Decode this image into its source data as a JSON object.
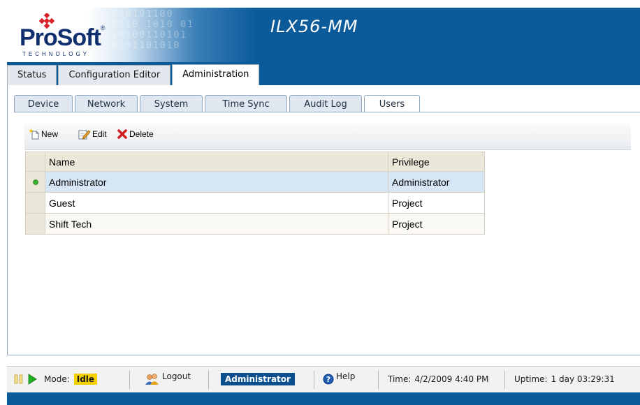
{
  "app": {
    "title": "ILX56-MM",
    "logo": {
      "brand": "ProSoft",
      "sub": "TECHNOLOGY",
      "reg_mark": "®",
      "binary_pattern": "010101100\n0110 1010 01\n10100110101\n0101101010"
    }
  },
  "main_tabs": [
    {
      "label": "Status",
      "active": false
    },
    {
      "label": "Configuration Editor",
      "active": false
    },
    {
      "label": "Administration",
      "active": true
    }
  ],
  "sub_tabs": [
    {
      "label": "Device",
      "active": false
    },
    {
      "label": "Network",
      "active": false
    },
    {
      "label": "System",
      "active": false
    },
    {
      "label": "Time Sync",
      "active": false
    },
    {
      "label": "Audit Log",
      "active": false
    },
    {
      "label": "Users",
      "active": true
    }
  ],
  "toolbar": {
    "new_label": "New",
    "edit_label": "Edit",
    "delete_label": "Delete"
  },
  "users_table": {
    "columns": [
      "Name",
      "Privilege"
    ],
    "rows": [
      {
        "name": "Administrator",
        "privilege": "Administrator",
        "selected": true
      },
      {
        "name": "Guest",
        "privilege": "Project",
        "selected": false
      },
      {
        "name": "Shift Tech",
        "privilege": "Project",
        "selected": false
      }
    ]
  },
  "statusbar": {
    "mode_label": "Mode:",
    "mode_value": "Idle",
    "logout_label": "Logout",
    "user": "Administrator",
    "help_label": "Help",
    "time_label": "Time:",
    "time_value": "4/2/2009 4:40 PM",
    "uptime_label": "Uptime:",
    "uptime_value": "1 day 03:29:31"
  },
  "colors": {
    "header_blue": "#0b5a9a",
    "mode_idle": "#f5d000",
    "user_badge": "#0b4f8f",
    "selected_row": "#d7e6f5",
    "delete_red": "#d02020"
  },
  "icons": [
    "pause-icon",
    "play-icon",
    "new-icon",
    "edit-icon",
    "delete-icon",
    "users-icon",
    "help-icon",
    "selected-row-icon"
  ]
}
